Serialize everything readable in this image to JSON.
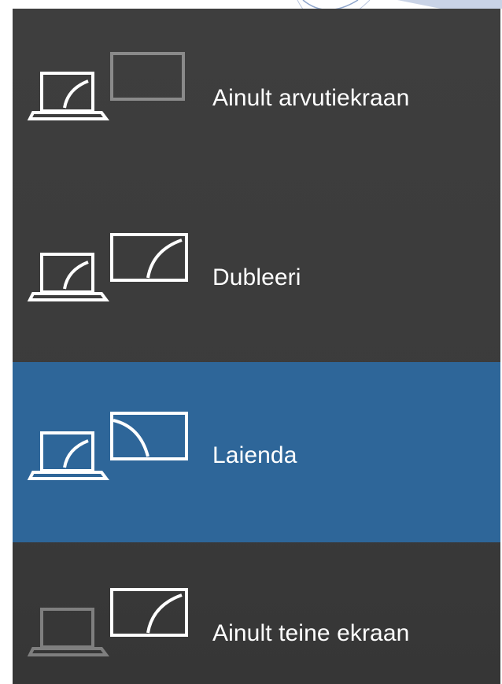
{
  "project_menu": {
    "colors": {
      "panel_background": "#3c3c3c",
      "selected_background": "#2e6699",
      "icon_active": "#ffffff",
      "icon_dimmed": "#8a8a8a",
      "text": "#ffffff"
    },
    "options": [
      {
        "label": "Ainult arvutiekraan",
        "selected": false,
        "icon": "pc-screen-only-icon",
        "laptop_active": true,
        "monitor_active": false
      },
      {
        "label": "Dubleeri",
        "selected": false,
        "icon": "duplicate-icon",
        "laptop_active": true,
        "monitor_active": true
      },
      {
        "label": "Laienda",
        "selected": true,
        "icon": "extend-icon",
        "laptop_active": true,
        "monitor_active": true
      },
      {
        "label": "Ainult teine ekraan",
        "selected": false,
        "icon": "second-screen-only-icon",
        "laptop_active": false,
        "monitor_active": true
      }
    ]
  }
}
